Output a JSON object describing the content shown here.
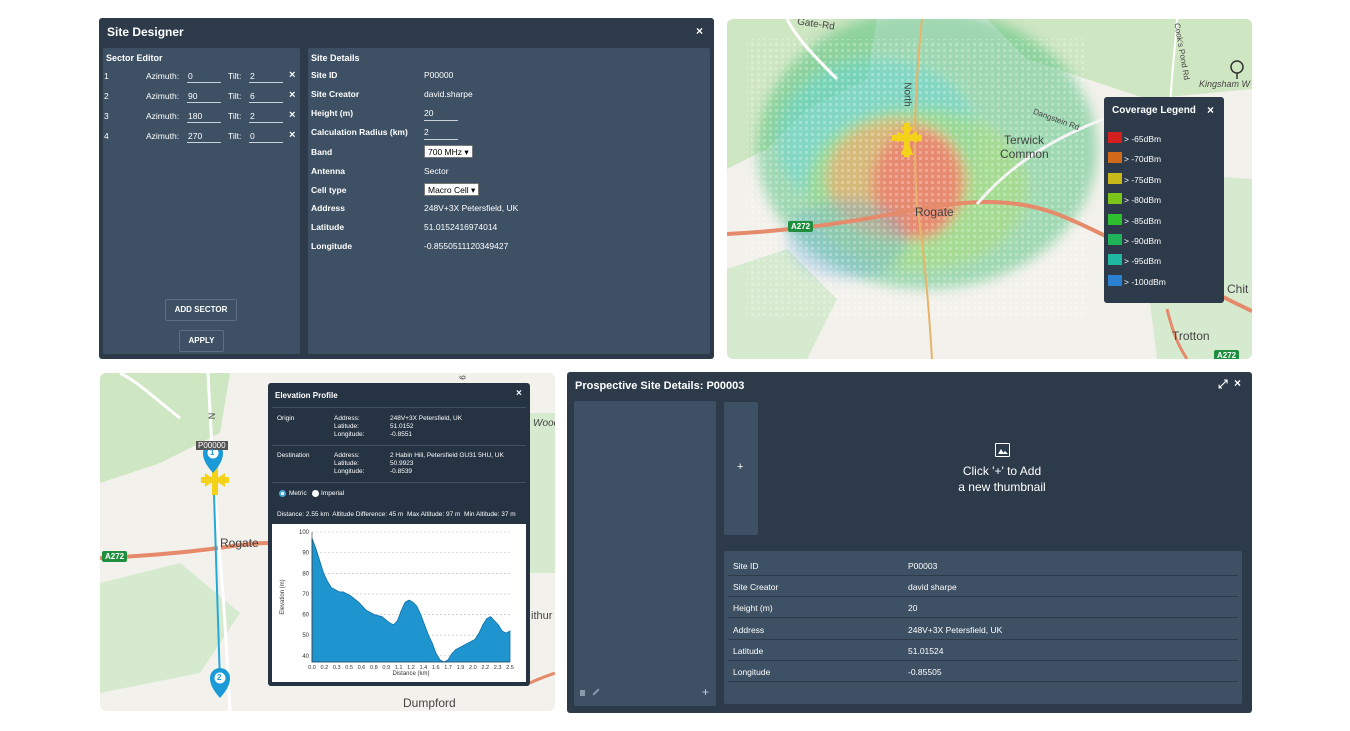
{
  "designer": {
    "title": "Site Designer",
    "close": "×",
    "sector_editor": {
      "heading": "Sector Editor",
      "azimuth_label": "Azimuth:",
      "tilt_label": "Tilt:",
      "remove": "×",
      "sectors": [
        {
          "num": "1",
          "azimuth": "0",
          "tilt": "2"
        },
        {
          "num": "2",
          "azimuth": "90",
          "tilt": "6"
        },
        {
          "num": "3",
          "azimuth": "180",
          "tilt": "2"
        },
        {
          "num": "4",
          "azimuth": "270",
          "tilt": "0"
        }
      ],
      "add_sector": "ADD SECTOR",
      "apply": "APPLY"
    },
    "details": {
      "heading": "Site Details",
      "rows": [
        {
          "k": "Site ID",
          "v": "P00000"
        },
        {
          "k": "Site Creator",
          "v": "david.sharpe"
        },
        {
          "k": "Height (m)",
          "v": "20"
        },
        {
          "k": "Calculation Radius (km)",
          "v": "2"
        },
        {
          "k": "Band",
          "v": "700 MHz"
        },
        {
          "k": "Antenna",
          "v": "Sector"
        },
        {
          "k": "Cell type",
          "v": "Macro Cell"
        },
        {
          "k": "Address",
          "v": "248V+3X Petersfield, UK"
        },
        {
          "k": "Latitude",
          "v": "51.0152416974014"
        },
        {
          "k": "Longitude",
          "v": "-0.8550511120349427"
        }
      ]
    }
  },
  "map1": {
    "labels": {
      "gate_rd": "Gate-Rd",
      "north": "North",
      "cooks_pond": "Cook's Pond Rd",
      "kingsham": "Kingsham W",
      "dangstein": "Dangstein Rd",
      "terwick": "Terwick",
      "common": "Common",
      "rogate": "Rogate",
      "a272": "A272",
      "chit": "Chit",
      "trotton": "Trotton",
      "a272b": "A272"
    },
    "colors": {
      "heat_red": "#e8715a",
      "heat_orange": "#f0a05a",
      "heat_green": "#4ec07a",
      "heat_cyan": "#5ad0c8",
      "heat_blue": "#4a9ed8"
    }
  },
  "legend": {
    "title": "Coverage Legend",
    "close": "×",
    "items": [
      {
        "color": "#d41f1f",
        "label": "> -65dBm"
      },
      {
        "color": "#d06a1a",
        "label": "> -70dBm"
      },
      {
        "color": "#c9b81a",
        "label": "> -75dBm"
      },
      {
        "color": "#7dc41a",
        "label": "> -80dBm"
      },
      {
        "color": "#2dbf2d",
        "label": "> -85dBm"
      },
      {
        "color": "#1fb35a",
        "label": "> -90dBm"
      },
      {
        "color": "#1fb8a0",
        "label": "> -95dBm"
      },
      {
        "color": "#2a7fd0",
        "label": "> -100dBm"
      }
    ]
  },
  "map2": {
    "labels": {
      "site": "P00000",
      "marker1": "1",
      "marker2": "2",
      "rogate": "Rogate",
      "a272": "A272",
      "wood": "Wood",
      "ithur": "ithur",
      "dumpford": "Dumpford",
      "north_n": "N",
      "nine": "9"
    },
    "colors": {
      "marker": "#1a9bd7",
      "route": "#25a9d8"
    }
  },
  "elevation": {
    "title": "Elevation Profile",
    "close": "×",
    "origin": {
      "label": "Origin",
      "address_k": "Address:",
      "address": "248V+3X Petersfield, UK",
      "lat_k": "Latitude:",
      "lat": "51.0152",
      "lon_k": "Longitude:",
      "lon": "-0.8551"
    },
    "destination": {
      "label": "Destination",
      "address_k": "Address:",
      "address": "2 Habin Hill, Petersfield GU31 5HU, UK",
      "lat_k": "Latitude:",
      "lat": "50.9923",
      "lon_k": "Longitude:",
      "lon": "-0.8539"
    },
    "units": {
      "metric": "Metric",
      "imperial": "Imperial",
      "selected": "Metric"
    },
    "stats": "Distance: 2.55 km  Altitude Difference: 45 m  Max Altitude: 97 m  Min Altitude: 37 m"
  },
  "chart_data": {
    "type": "area",
    "xlabel": "Distance (km)",
    "ylabel": "Elevation (m)",
    "ylim": [
      37,
      100
    ],
    "xlim": [
      0,
      2.55
    ],
    "x_ticks": [
      "0.0",
      "0.2",
      "0.3",
      "0.5",
      "0.6",
      "0.8",
      "0.9",
      "1.1",
      "1.2",
      "1.4",
      "1.6",
      "1.7",
      "1.9",
      "2.0",
      "2.2",
      "2.3",
      "2.5"
    ],
    "y_ticks": [
      40,
      50,
      60,
      70,
      80,
      90,
      100
    ],
    "grid": true,
    "color": "#1f95d0",
    "series": [
      {
        "x": [
          0.0,
          0.05,
          0.1,
          0.15,
          0.2,
          0.25,
          0.3,
          0.35,
          0.4,
          0.45,
          0.5,
          0.6,
          0.7,
          0.8,
          0.9,
          1.0,
          1.05,
          1.1,
          1.15,
          1.2,
          1.25,
          1.3,
          1.35,
          1.4,
          1.45,
          1.5,
          1.55,
          1.6,
          1.65,
          1.7,
          1.75,
          1.8,
          1.85,
          1.9,
          1.95,
          2.0,
          2.05,
          2.1,
          2.15,
          2.2,
          2.25,
          2.3,
          2.35,
          2.4,
          2.45,
          2.5,
          2.55
        ],
        "y": [
          97,
          92,
          86,
          80,
          76,
          73,
          72,
          71,
          71,
          70,
          69,
          66,
          62,
          60,
          59,
          56,
          55,
          57,
          62,
          66,
          67,
          66,
          64,
          60,
          55,
          50,
          46,
          41,
          38,
          37,
          38,
          41,
          43,
          44,
          45,
          46,
          47,
          48,
          51,
          55,
          58,
          59,
          57,
          55,
          52,
          51,
          52
        ]
      }
    ]
  },
  "prospective": {
    "title": "Prospective Site Details: P00003",
    "expand": "⤢",
    "close": "×",
    "add": "+",
    "empty_title": "Click '+' to Add",
    "empty_sub": "a new thumbnail",
    "list_add": "+",
    "rows": [
      {
        "k": "Site ID",
        "v": "P00003"
      },
      {
        "k": "Site Creator",
        "v": "david sharpe"
      },
      {
        "k": "Height (m)",
        "v": "20"
      },
      {
        "k": "Address",
        "v": "248V+3X Petersfield, UK"
      },
      {
        "k": "Latitude",
        "v": "51.01524"
      },
      {
        "k": "Longitude",
        "v": "-0.85505"
      }
    ]
  }
}
